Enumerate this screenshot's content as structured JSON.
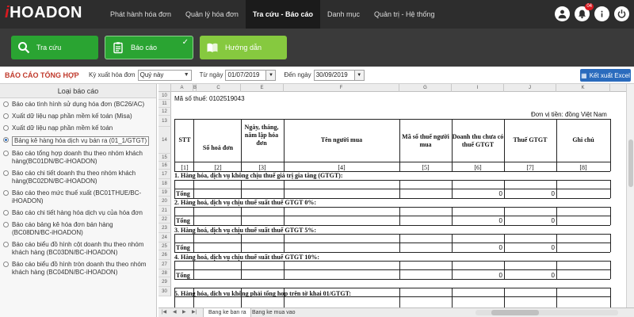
{
  "app": {
    "logo": "HOADON",
    "logo_prefix": "i"
  },
  "nav": {
    "items": [
      {
        "label": "Phát hành hóa đơn",
        "active": false
      },
      {
        "label": "Quản lý hóa đơn",
        "active": false
      },
      {
        "label": "Tra cứu - Báo cáo",
        "active": true
      },
      {
        "label": "Danh mục",
        "active": false
      },
      {
        "label": "Quản trị - Hệ thống",
        "active": false
      }
    ],
    "notification_count": "04"
  },
  "toolbar": {
    "lookup_label": "Tra cứu",
    "report_label": "Báo cáo",
    "guide_label": "Hướng dẫn"
  },
  "filter": {
    "report_title": "BÁO CÁO TỔNG HỢP",
    "period_label": "Kỳ xuất hóa đơn",
    "period_value": "Quý này",
    "from_label": "Từ ngày",
    "from_value": "01/07/2019",
    "to_label": "Đến ngày",
    "to_value": "30/09/2019",
    "export_label": "Kết xuất Excel"
  },
  "left_panel": {
    "header": "Loại báo cáo",
    "items": [
      "Báo cáo tình hình sử dụng hóa đơn (BC26/AC)",
      "Xuất dữ liệu nạp phần mềm kế toán (Misa)",
      "Xuất dữ liệu nạp phần mềm kế toán",
      "Bảng kê hàng hóa dịch vụ bán ra (01_1/GTGT)",
      "Báo cáo tổng hợp doanh thu theo nhóm khách hàng(BC01DN/BC-iHOADON)",
      "Báo cáo chi tiết doanh thu theo nhóm khách hàng(BC02DN/BC-iHOADON)",
      "Báo cáo theo mức thuế xuất (BC01THUE/BC-iHOADON)",
      "Báo cáo chi tiết hàng hóa dịch vụ của hóa đơn",
      "Báo cáo bảng kê hóa đơn bán hàng (BC08DN/BC-iHOADON)",
      "Báo cáo biểu đồ hình cột doanh thu theo nhóm khách hàng (BC03DN/BC-iHOADON)",
      "Báo cáo biểu đồ hình tròn doanh thu theo nhóm khách hàng (BC04DN/BC-iHOADON)"
    ],
    "selected_index": 3
  },
  "sheet": {
    "columns": [
      "A",
      "B",
      "C",
      "D",
      "E",
      "F",
      "G",
      "H",
      "I",
      "J",
      "K"
    ],
    "rows": [
      "10",
      "11",
      "12",
      "13",
      "14",
      "15",
      "16",
      "17",
      "18",
      "19",
      "20",
      "21",
      "22",
      "23",
      "24",
      "25",
      "26",
      "27",
      "28",
      "29",
      "30"
    ],
    "tax_code": "Mã số thuế:  0102519043",
    "currency_note": "Đơn vị tiền: đồng Việt Nam",
    "headers": {
      "stt": "STT",
      "invoice_no": "Số hoá đơn",
      "date": "Ngày, tháng, năm lập hóa đơn",
      "buyer": "Tên người mua",
      "buyer_tax": "Mã số thuế người mua",
      "revenue": "Doanh thu chưa có thuế GTGT",
      "vat": "Thuế GTGT",
      "note": "Ghi chú"
    },
    "index_labels": [
      "[1]",
      "[2]",
      "[3]",
      "[4]",
      "[5]",
      "[6]",
      "[7]",
      "[8]"
    ],
    "sections": [
      "1. Hàng hóa, dịch vụ không chịu thuế giá trị gia tăng (GTGT):",
      "2. Hàng hoá, dịch vụ chịu thuế suất thuế GTGT 0%:",
      "3. Hàng hoá, dịch vụ chịu thuế suất thuế GTGT 5%:",
      "4. Hàng hoá, dịch vụ chịu thuế suất thuế GTGT 10%:",
      "5. Hàng hóa, dịch vụ không phải tổng hợp trên tờ khai 01/GTGT:"
    ],
    "total_label": "Tổng",
    "zero": "0"
  },
  "tabs": {
    "items": [
      "Bang ke ban ra",
      "Bang ke mua vao"
    ]
  },
  "colors": {
    "topbar": "#2d2d2d",
    "accent_green": "#2aa432",
    "guide_green": "#86c93f",
    "report_title_red": "#c0392b",
    "export_blue": "#2a6bbd"
  }
}
